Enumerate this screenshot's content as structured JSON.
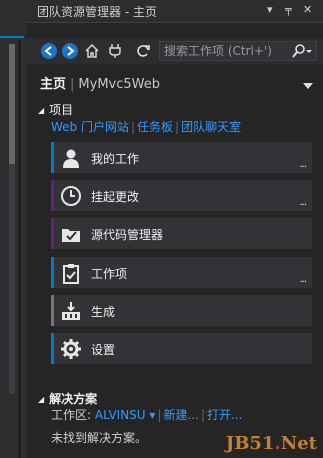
{
  "window": {
    "title": "团队资源管理器 - 主页",
    "dropdown_glyph": "▾",
    "pin_glyph": "╤",
    "close_glyph": "✕"
  },
  "toolbar": {
    "search_placeholder": "搜索工作项 (Ctrl+')",
    "search_icon": "search-icon"
  },
  "home": {
    "title": "主页",
    "separator": "|",
    "project": "MyMvc5Web"
  },
  "project_section": {
    "label": "项目",
    "links": [
      "Web 门户网站",
      "任务板",
      "团队聊天室"
    ]
  },
  "tiles": [
    {
      "label": "我的工作",
      "icon": "user-icon",
      "accent": "#007acc",
      "has_more": true
    },
    {
      "label": "挂起更改",
      "icon": "clock-icon",
      "accent": "#68217a",
      "has_more": true
    },
    {
      "label": "源代码管理器",
      "icon": "folder-check-icon",
      "accent": "#68217a",
      "has_more": false
    },
    {
      "label": "工作项",
      "icon": "clipboard-check-icon",
      "accent": "#007acc",
      "has_more": true
    },
    {
      "label": "生成",
      "icon": "build-icon",
      "accent": "#777777",
      "has_more": false
    },
    {
      "label": "设置",
      "icon": "gear-icon",
      "accent": "#007acc",
      "has_more": false
    }
  ],
  "more_glyph": "...",
  "solution_section": {
    "label": "解决方案",
    "workspace_label": "工作区:",
    "workspace_value": "ALVINSU",
    "new_link": "新建...",
    "open_link": "打开...",
    "empty_text": "未找到解决方案。"
  },
  "watermark": {
    "left": "JB51",
    "dot": ".",
    "right": "Net"
  },
  "colors": {
    "accent_blue": "#007acc",
    "link_blue": "#3399ff",
    "accent_purple": "#68217a"
  }
}
